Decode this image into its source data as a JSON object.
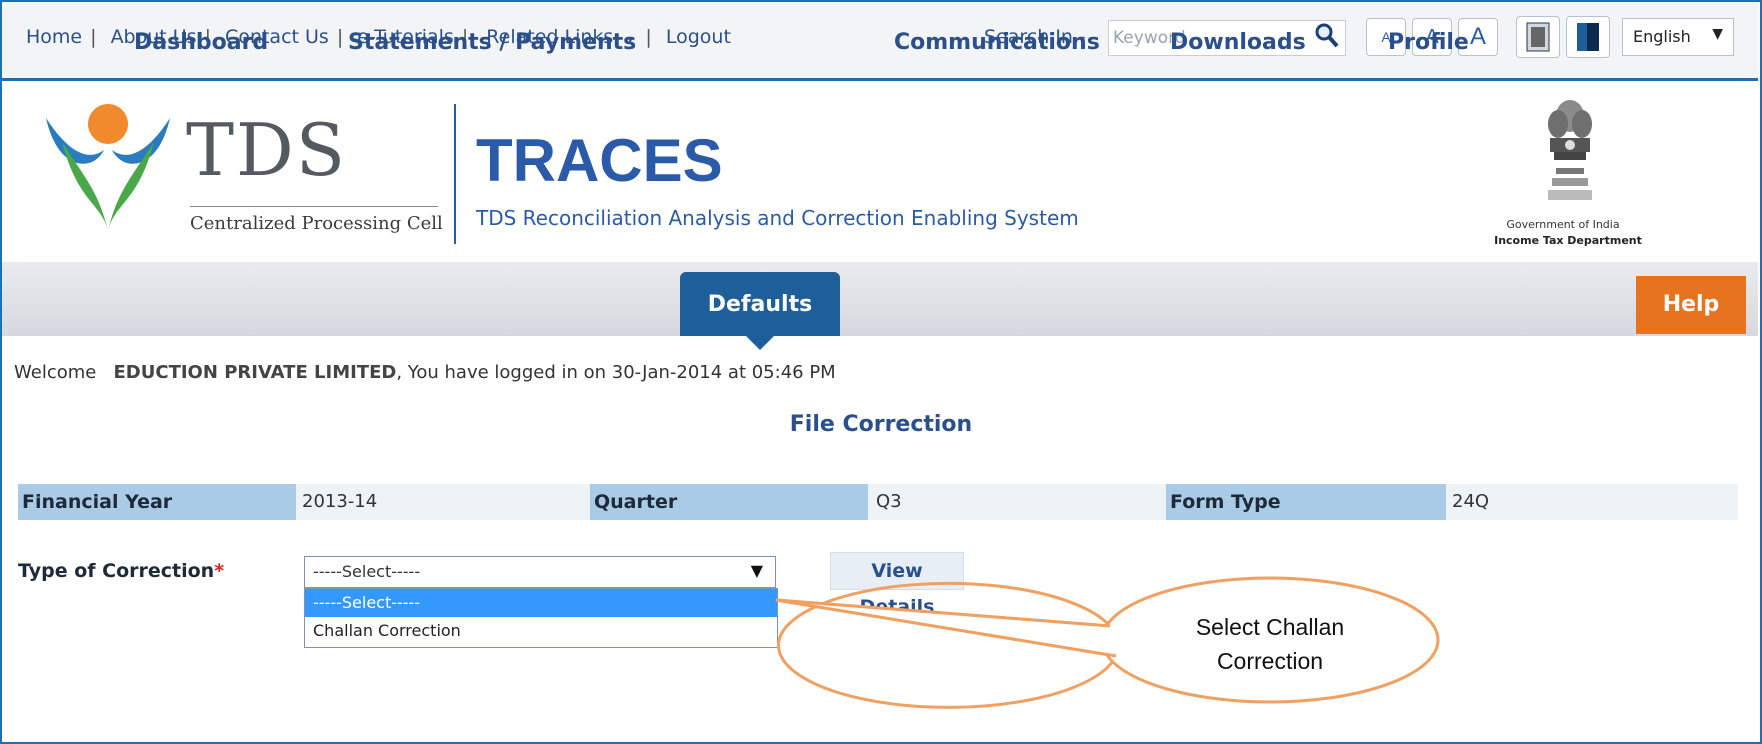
{
  "top_links": [
    "Home",
    "About Us",
    "Contact Us",
    "e-Tutorials",
    "Related Links",
    "Logout"
  ],
  "search": {
    "label": "Search In",
    "placeholder": "Keyword"
  },
  "font_buttons": [
    "A",
    "A",
    "A"
  ],
  "language": "English",
  "logo": {
    "main": "TDS",
    "sub": "Centralized Processing Cell"
  },
  "header": {
    "title": "TRACES",
    "subtitle": "TDS Reconciliation Analysis and Correction Enabling System",
    "gov_line1": "Government of India",
    "gov_line2": "Income Tax Department"
  },
  "nav": {
    "items": [
      "Dashboard",
      "Statements / Payments",
      "Defaults",
      "Communications",
      "Downloads",
      "Profile"
    ],
    "active": "Defaults",
    "help": "Help"
  },
  "welcome": {
    "prefix": "Welcome",
    "company": "EDUCTION PRIVATE LIMITED",
    "suffix": ", You have logged in on 30-Jan-2014 at 05:46 PM"
  },
  "page_title": "File Correction",
  "info": {
    "fy_label": "Financial Year",
    "fy_value": "2013-14",
    "quarter_label": "Quarter",
    "quarter_value": "Q3",
    "form_label": "Form Type",
    "form_value": "24Q"
  },
  "correction": {
    "label": "Type of Correction",
    "required_mark": "*",
    "selected": "-----Select-----",
    "options": [
      "-----Select-----",
      "Challan Correction"
    ],
    "view_button": "View Details"
  },
  "callout": {
    "text_line1": "Select  Challan",
    "text_line2": "Correction"
  },
  "colors": {
    "brand_blue": "#2b5ba8",
    "nav_active": "#1e5e99",
    "help_orange": "#e8731e",
    "callout_orange": "#f0a060"
  }
}
